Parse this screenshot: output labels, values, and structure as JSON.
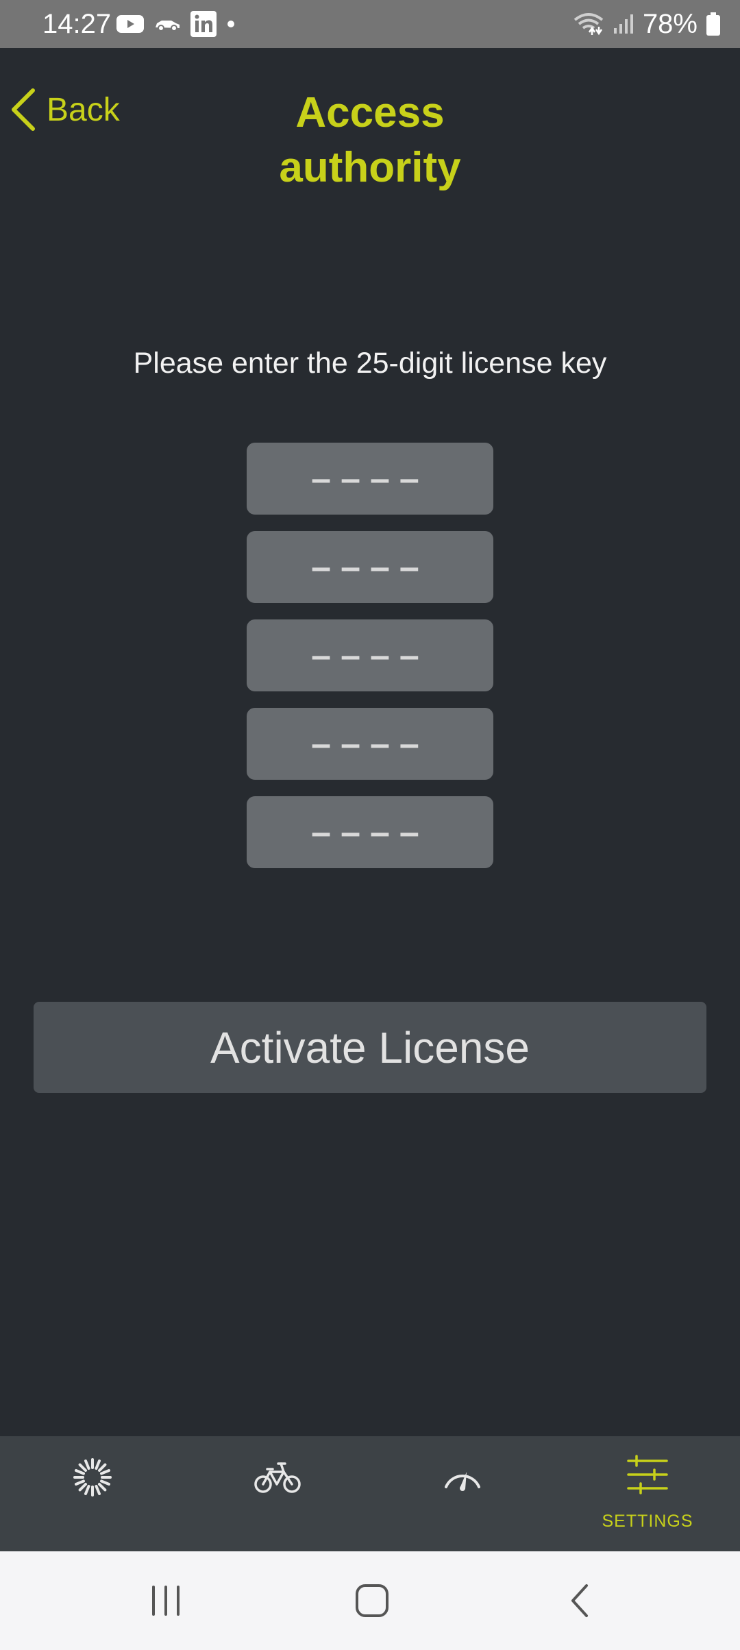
{
  "status_bar": {
    "time": "14:27",
    "battery": "78%",
    "left_icons": [
      "youtube-icon",
      "car-icon",
      "linkedin-icon",
      "dot-icon"
    ],
    "right_icons": [
      "wifi-icon",
      "signal-icon",
      "battery-icon"
    ]
  },
  "header": {
    "back_label": "Back",
    "title": "Access authority"
  },
  "form": {
    "prompt": "Please enter the 25-digit license key",
    "fields": [
      {
        "placeholder": "––––",
        "value": ""
      },
      {
        "placeholder": "––––",
        "value": ""
      },
      {
        "placeholder": "––––",
        "value": ""
      },
      {
        "placeholder": "––––",
        "value": ""
      },
      {
        "placeholder": "––––",
        "value": ""
      }
    ],
    "activate_label": "Activate License"
  },
  "bottom_nav": {
    "items": [
      {
        "icon": "loading-spinner-icon",
        "label": ""
      },
      {
        "icon": "bicycle-icon",
        "label": ""
      },
      {
        "icon": "speedometer-icon",
        "label": ""
      },
      {
        "icon": "sliders-icon",
        "label": "SETTINGS",
        "active": true
      }
    ]
  },
  "colors": {
    "accent": "#c8d11a",
    "background": "#272b30",
    "nav_background": "#3d4246",
    "field_background": "#686c70",
    "button_background": "#4b5055"
  }
}
